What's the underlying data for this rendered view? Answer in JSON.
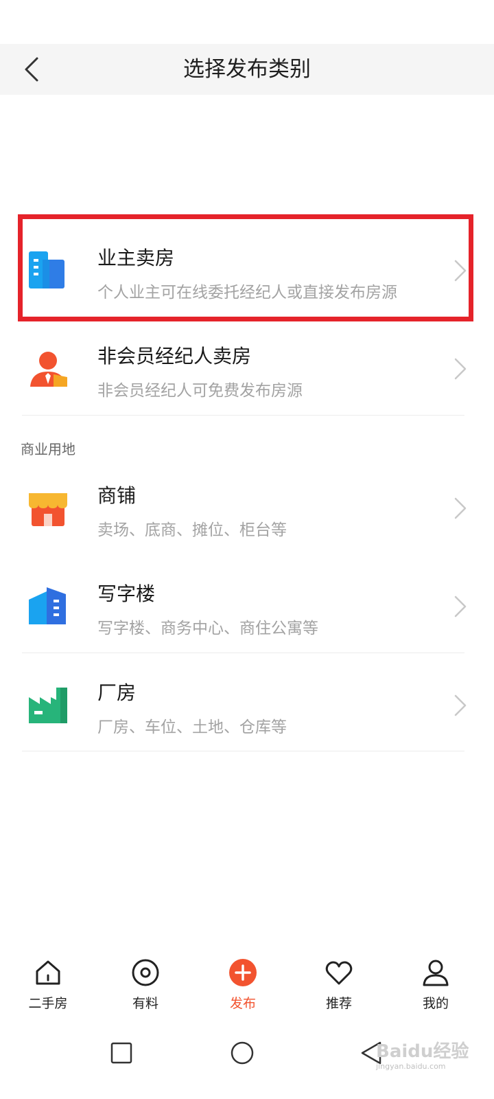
{
  "header": {
    "title": "选择发布类别"
  },
  "items": [
    {
      "title": "业主卖房",
      "subtitle": "个人业主可在线委托经纪人或直接发布房源",
      "icon": "buildings-blue-icon"
    },
    {
      "title": "非会员经纪人卖房",
      "subtitle": "非会员经纪人可免费发布房源",
      "icon": "agent-person-icon"
    },
    {
      "title": "商铺",
      "subtitle": "卖场、底商、摊位、柜台等",
      "icon": "shop-storefront-icon"
    },
    {
      "title": "写字楼",
      "subtitle": "写字楼、商务中心、商住公寓等",
      "icon": "office-building-icon"
    },
    {
      "title": "厂房",
      "subtitle": "厂房、车位、土地、仓库等",
      "icon": "factory-icon"
    }
  ],
  "section": {
    "commercial_label": "商业用地"
  },
  "tabbar": {
    "tabs": [
      {
        "label": "二手房",
        "icon": "home-icon"
      },
      {
        "label": "有料",
        "icon": "target-circle-icon"
      },
      {
        "label": "发布",
        "icon": "plus-circle-icon",
        "active": true
      },
      {
        "label": "推荐",
        "icon": "heart-icon"
      },
      {
        "label": "我的",
        "icon": "person-icon"
      }
    ]
  },
  "colors": {
    "accent": "#f2532f",
    "highlight": "#e5232a"
  },
  "watermark": {
    "brand": "Baidu经验",
    "sub": "jingyan.baidu.com"
  }
}
